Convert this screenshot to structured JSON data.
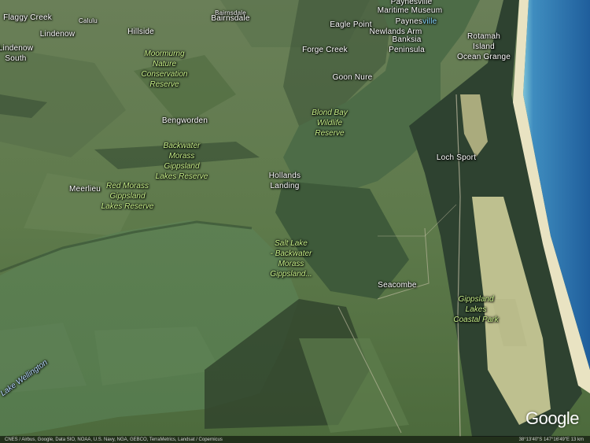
{
  "map": {
    "places": [
      {
        "id": "flaggy-creek",
        "text": "Flaggy Creek"
      },
      {
        "id": "calulu",
        "text": "Calulu"
      },
      {
        "id": "bairnsdale-small",
        "text": "Bairnsdale"
      },
      {
        "id": "bairnsdale",
        "text": "Bairnsdale"
      },
      {
        "id": "paynesville-top",
        "text": "Paynesville"
      },
      {
        "id": "maritime-museum",
        "text": "Maritime Museum"
      },
      {
        "id": "lindenow",
        "text": "Lindenow"
      },
      {
        "id": "hillside",
        "text": "Hillside"
      },
      {
        "id": "eagle-point",
        "text": "Eagle Point"
      },
      {
        "id": "newlands-arm",
        "text": "Newlands Arm"
      },
      {
        "id": "banksia-peninsula",
        "text": "Banksia\nPeninsula"
      },
      {
        "id": "rotamah-island",
        "text": "Rotamah\nIsland"
      },
      {
        "id": "lindenow-south",
        "text": "Lindenow\nSouth"
      },
      {
        "id": "forge-creek",
        "text": "Forge Creek"
      },
      {
        "id": "ocean-grange",
        "text": "Ocean Grange"
      },
      {
        "id": "goon-nure",
        "text": "Goon Nure"
      },
      {
        "id": "bengworden",
        "text": "Bengworden"
      },
      {
        "id": "loch-sport",
        "text": "Loch Sport"
      },
      {
        "id": "hollands-landing",
        "text": "Hollands\nLanding"
      },
      {
        "id": "meerlieu",
        "text": "Meerlieu"
      },
      {
        "id": "seacombe",
        "text": "Seacombe"
      }
    ],
    "paynesville_label": {
      "prefix": "Paynes",
      "suffix": "ville"
    },
    "reserves": [
      {
        "id": "moormurng",
        "text": "Moormurng\nNature\nConservation\nReserve"
      },
      {
        "id": "blond-bay",
        "text": "Blond Bay\nWildlife\nReserve"
      },
      {
        "id": "backwater-morass",
        "text": "Backwater\nMorass\nGippsland\nLakes Reserve"
      },
      {
        "id": "red-morass",
        "text": "Red Morass\nGippsland\nLakes Reserve"
      },
      {
        "id": "salt-lake",
        "text": "Salt Lake\n- Backwater\nMorass\nGippsland..."
      },
      {
        "id": "gippsland-lakes-park",
        "text": "Gippsland\nLakes\nCoastal Park"
      }
    ],
    "water_labels": [
      {
        "id": "lake-wellington",
        "text": "Lake Wellington"
      }
    ]
  },
  "footer": {
    "attribution": "CNES / Airbus, Google, Data SIO, NOAA, U.S. Navy, NGA, GEBCO, TerraMetrics, Landsat / Copernicus",
    "coordinates": "38°13'40\"S 147°16'49\"E  13 km",
    "logo": "Google"
  },
  "colors": {
    "land": "#5f7a4c",
    "lake": "#4f6e45",
    "ocean": "#2c6fa8",
    "beach": "#d7d6a0",
    "reserve_text": "#c9f28a",
    "place_text": "#ffffff"
  }
}
